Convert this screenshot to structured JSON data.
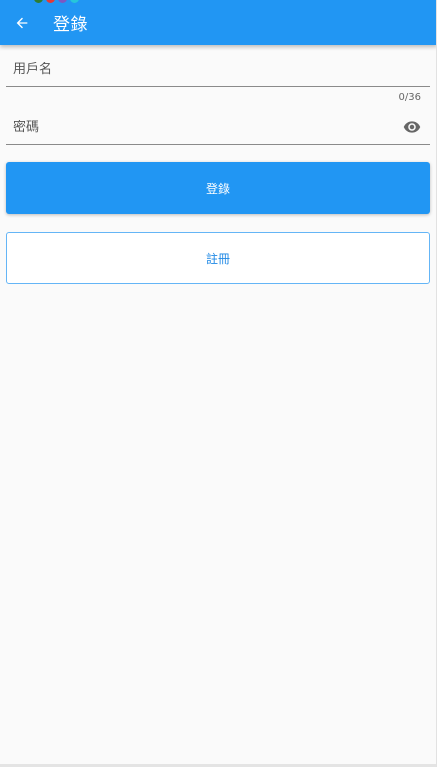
{
  "appbar": {
    "title": "登錄",
    "color": "#2196f3"
  },
  "status_dot_colors": [
    "#2e7d32",
    "#e53935",
    "#7e57c2",
    "#26c6da"
  ],
  "form": {
    "username": {
      "placeholder": "用戶名",
      "value": "",
      "counter": "0/36"
    },
    "password": {
      "placeholder": "密碼",
      "value": "",
      "toggle_icon": "eye-icon"
    }
  },
  "buttons": {
    "login_label": "登錄",
    "register_label": "註冊"
  },
  "icons": {
    "back": "arrow-left-icon",
    "visibility": "eye-icon"
  }
}
